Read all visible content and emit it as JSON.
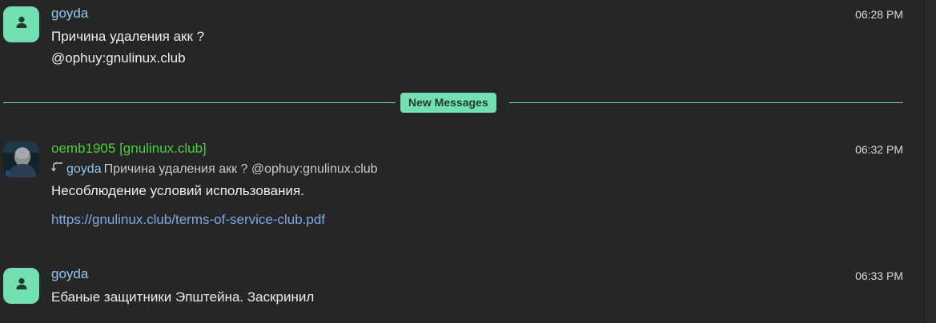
{
  "messages": [
    {
      "sender": "goyda",
      "time": "06:28 PM",
      "lines": [
        "Причина удаления акк ?",
        "@ophuy:gnulinux.club"
      ]
    },
    {
      "sender": "oemb1905 [gnulinux.club]",
      "time": "06:32 PM",
      "reply": {
        "sender": "goyda",
        "text": "Причина удаления акк ? @ophuy:gnulinux.club"
      },
      "lines": [
        "Несоблюдение условий использования."
      ],
      "link": "https://gnulinux.club/terms-of-service-club.pdf"
    },
    {
      "sender": "goyda",
      "time": "06:33 PM",
      "lines": [
        "Ебаные защитники Эпштейна. Заскринил"
      ]
    }
  ],
  "divider": {
    "label": "New Messages"
  },
  "colors": {
    "background": "#262626",
    "accent": "#73e0b1",
    "sender_blue": "#8cc8f2",
    "sender_green": "#4ccf3b",
    "link": "#7ea9e0"
  },
  "icons": {
    "default_avatar": "person-icon",
    "reply": "reply-arrow-icon"
  }
}
